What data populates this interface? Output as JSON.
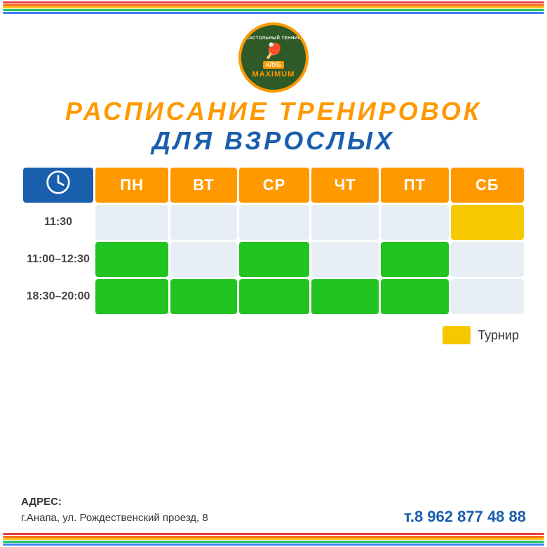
{
  "logo": {
    "top_text": "НАСТОЛЬНЫЙ ТЕННИС",
    "club_label": "КЛУБ",
    "name": "MAXIMUM",
    "paddle": "🏓"
  },
  "title": {
    "line1": "РАСПИСАНИЕ ТРЕНИРОВОК",
    "line2": "ДЛЯ ВЗРОСЛЫХ"
  },
  "table": {
    "header": {
      "clock_label": "⏰",
      "days": [
        "ПН",
        "ВТ",
        "СР",
        "ЧТ",
        "ПТ",
        "СБ"
      ]
    },
    "rows": [
      {
        "time": "11:30",
        "cells": [
          "empty",
          "empty",
          "empty",
          "empty",
          "empty",
          "yellow"
        ]
      },
      {
        "time": "11:00–12:30",
        "cells": [
          "green",
          "empty",
          "green",
          "empty",
          "green",
          "empty"
        ]
      },
      {
        "time": "18:30–20:00",
        "cells": [
          "green",
          "green",
          "green",
          "green",
          "green",
          "empty"
        ]
      }
    ]
  },
  "legend": {
    "box_color": "#f5c800",
    "label": "Турнир"
  },
  "footer": {
    "address_label": "АДРЕС:",
    "address": "г.Анапа, ул. Рождественский проезд, 8",
    "phone": "т.8 962 877 48 88"
  },
  "colors": {
    "orange": "#f90",
    "blue": "#1a5fad",
    "green": "#22c422",
    "yellow": "#f5c800",
    "light_blue_bg": "#e8eef5"
  },
  "rainbow_lines": [
    {
      "color": "#e84040"
    },
    {
      "color": "#f97316"
    },
    {
      "color": "#fbbf24"
    },
    {
      "color": "#22c55e"
    },
    {
      "color": "#3b82f6"
    },
    {
      "color": "#8b5cf6"
    }
  ]
}
